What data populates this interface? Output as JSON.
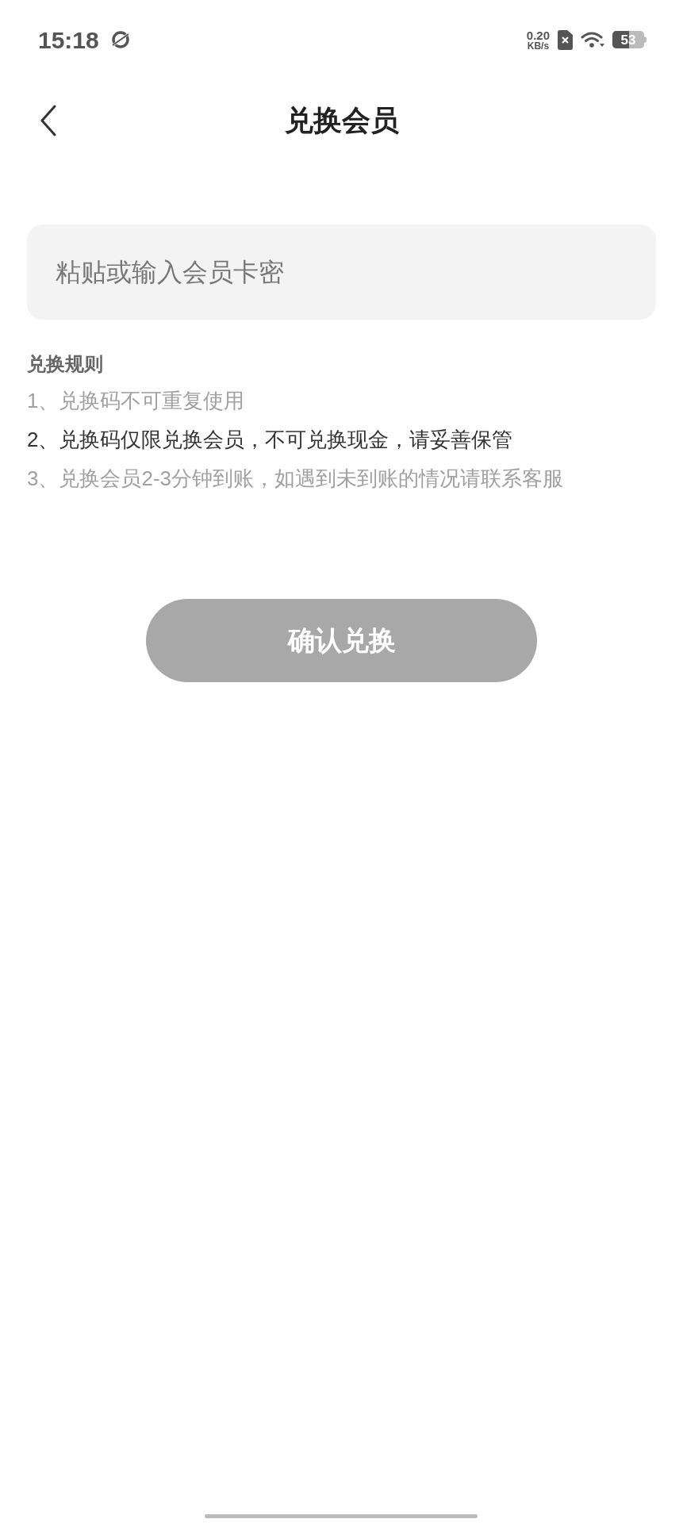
{
  "status_bar": {
    "time": "15:18",
    "net_speed": "0.20",
    "net_unit": "KB/s",
    "battery": "53"
  },
  "header": {
    "title": "兑换会员"
  },
  "code_field": {
    "placeholder": "粘贴或输入会员卡密"
  },
  "rules": {
    "title": "兑换规则",
    "items": [
      {
        "text": "1、兑换码不可重复使用",
        "emphasized": false
      },
      {
        "text": "2、兑换码仅限兑换会员，不可兑换现金，请妥善保管",
        "emphasized": true
      },
      {
        "text": "3、兑换会员2-3分钟到账，如遇到未到账的情况请联系客服",
        "emphasized": false
      }
    ]
  },
  "confirm_button": {
    "label": "确认兑换",
    "disabled": true
  }
}
